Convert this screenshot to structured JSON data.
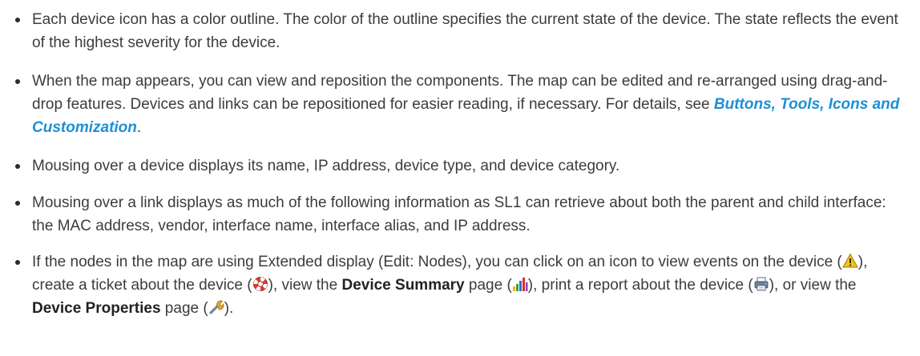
{
  "bullets": [
    {
      "text": "Each device icon has a color outline. The color of the outline specifies the current state of the device. The state reflects the event of the highest severity for the device."
    },
    {
      "text_before": "When the map appears, you can view and reposition the components. The map can be edited and re-arranged using drag-and-drop features. Devices and links can be repositioned for easier reading, if necessary. For details, see ",
      "link_text": "Buttons, Tools, Icons and Customization",
      "text_after": "."
    },
    {
      "text": "Mousing over a device displays its name, IP address, device type, and device category."
    },
    {
      "text": "Mousing over a link displays as much of the following information as SL1 can retrieve about both the parent and child interface: the MAC address, vendor, interface name, interface alias, and IP address."
    },
    {
      "part1": "If the nodes in the map are using Extended display (Edit: Nodes), you can click on an icon to view events on the device (",
      "part2": "), create a ticket about the device (",
      "part3": "), view the ",
      "bold1": "Device Summary",
      "part4": " page (",
      "part5": "), print a report about the device (",
      "part6": "), or view the ",
      "bold2": "Device Properties",
      "part7": " page (",
      "part8": ")."
    }
  ],
  "icons": [
    "warning-icon",
    "lifebuoy-icon",
    "bar-chart-icon",
    "printer-icon",
    "wrench-icon"
  ]
}
